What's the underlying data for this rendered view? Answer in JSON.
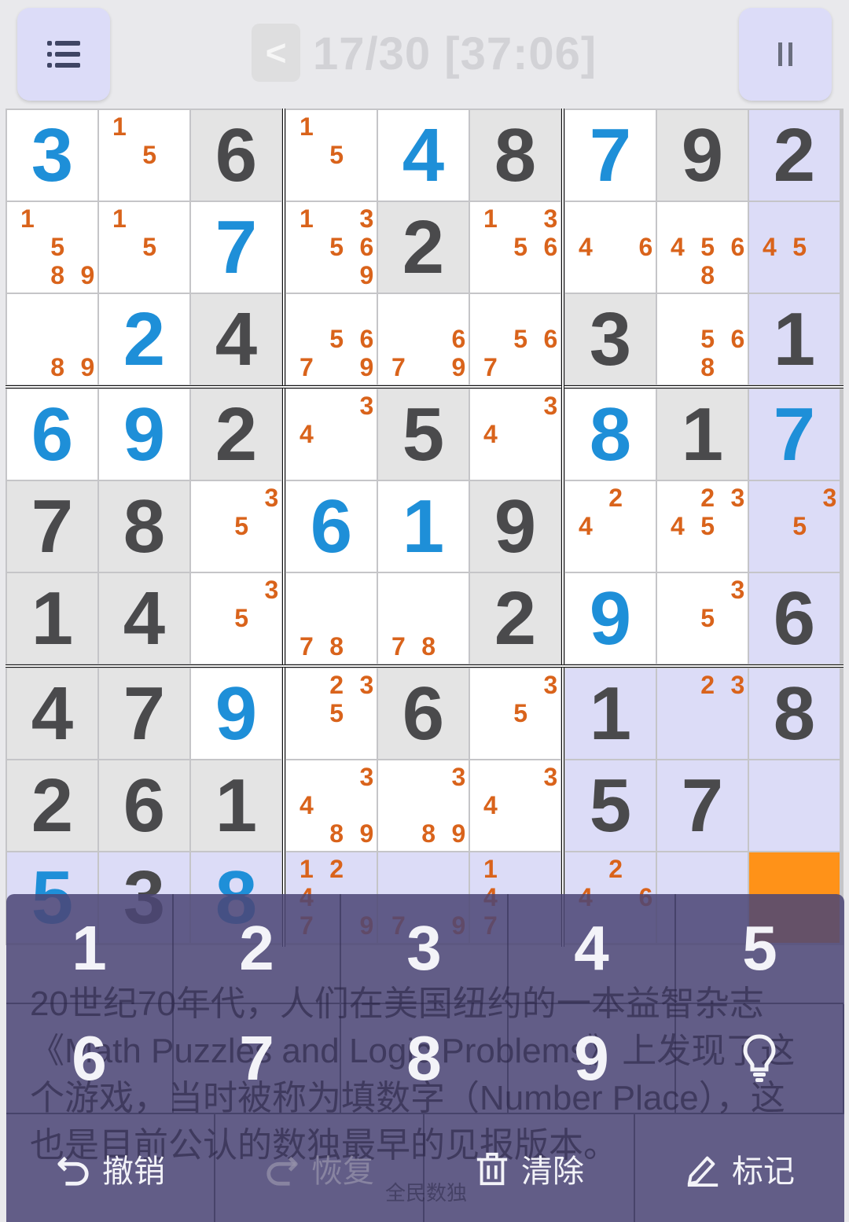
{
  "header": {
    "prev_label": "<",
    "title": "17/30 [37:06]"
  },
  "board": {
    "rows": [
      [
        "u:3",
        "n:15",
        "g:6",
        "n:15",
        "u:4",
        "g:8",
        "u:7",
        "g:9",
        "g:2"
      ],
      [
        "n:1589",
        "n:15",
        "u:7",
        "n:135369",
        "g:2",
        "n:1356",
        "n:46",
        "n:4568",
        "n:45"
      ],
      [
        "n:89",
        "u:2",
        "g:4",
        "n:5679",
        "n:679",
        "n:567",
        "g:3",
        "n:568",
        "g:1"
      ],
      [
        "u:6",
        "u:9",
        "g:2",
        "n:34",
        "g:5",
        "n:34",
        "u:8",
        "g:1",
        "u:7"
      ],
      [
        "g:7",
        "g:8",
        "n:35",
        "u:6",
        "u:1",
        "g:9",
        "n:24",
        "n:2345",
        "n:35"
      ],
      [
        "g:1",
        "g:4",
        "n:35",
        "n:78",
        "n:78",
        "g:2",
        "u:9",
        "n:35",
        "g:6"
      ],
      [
        "g:4",
        "g:7",
        "u:9",
        "n:235",
        "g:6",
        "n:35",
        "g:1",
        "n:23",
        "g:8"
      ],
      [
        "g:2",
        "g:6",
        "g:1",
        "n:3489",
        "n:389",
        "n:34",
        "g:5",
        "g:7",
        "e:"
      ],
      [
        "u:5",
        "g:3",
        "u:8",
        "n:12479",
        "n:79",
        "n:147",
        "n:246",
        "e:",
        "e:"
      ]
    ],
    "highlight_col": 8,
    "highlight_row": 8,
    "highlight_box": [
      2,
      2
    ],
    "selected": [
      8,
      8
    ]
  },
  "keypad": {
    "keys_row1": [
      "1",
      "2",
      "3",
      "4",
      "5"
    ],
    "keys_row2": [
      "6",
      "7",
      "8",
      "9"
    ],
    "hint_icon": "lightbulb-icon",
    "actions": {
      "undo": "撤销",
      "redo": "恢复",
      "clear": "清除",
      "note": "标记"
    }
  },
  "background_text": {
    "article": "20世纪70年代，人们在美国纽约的一本益智杂志《Math Puzzles and Logic Problems》上发现了这个游戏，当时被称为填数字（Number Place），这也是目前公认的数独最早的见报版本。",
    "watermark": "全民数独"
  },
  "colors": {
    "given_digit": "#4a4a4c",
    "user_digit": "#1e8fd8",
    "note": "#d9631b",
    "selected_cell": "#ff9218",
    "highlight_cell": "#dcdcf7",
    "pad_overlay": "#4c4676"
  }
}
